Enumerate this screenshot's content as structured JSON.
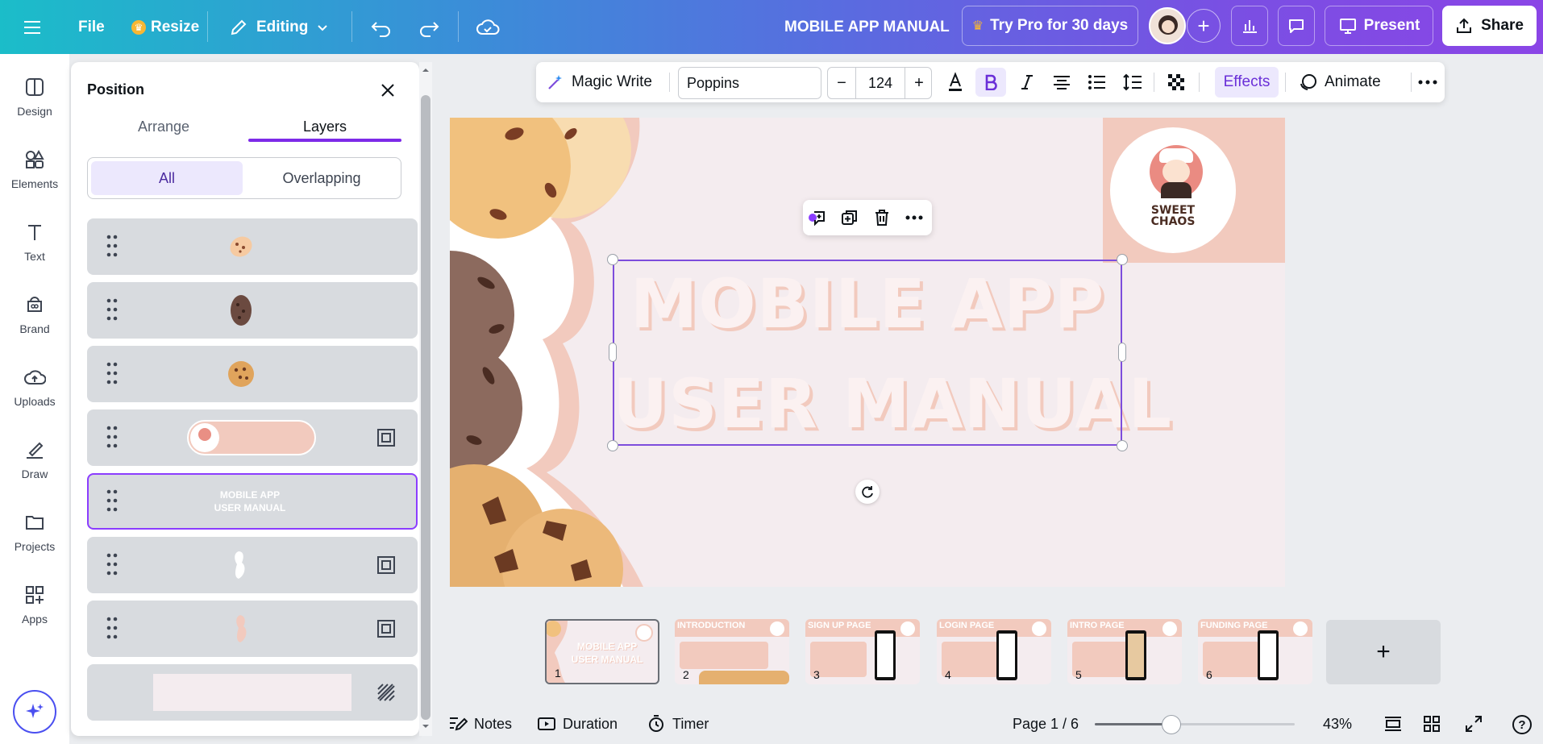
{
  "topbar": {
    "file_label": "File",
    "resize_label": "Resize",
    "editing_label": "Editing",
    "doc_title": "MOBILE APP MANUAL",
    "try_pro_label": "Try Pro for 30 days",
    "present_label": "Present",
    "share_label": "Share"
  },
  "rail": {
    "items": [
      {
        "label": "Design",
        "icon": "design-icon"
      },
      {
        "label": "Elements",
        "icon": "elements-icon"
      },
      {
        "label": "Text",
        "icon": "text-icon"
      },
      {
        "label": "Brand",
        "icon": "brand-icon"
      },
      {
        "label": "Uploads",
        "icon": "uploads-icon"
      },
      {
        "label": "Draw",
        "icon": "draw-icon"
      },
      {
        "label": "Projects",
        "icon": "projects-icon"
      },
      {
        "label": "Apps",
        "icon": "apps-icon"
      }
    ]
  },
  "panel": {
    "title": "Position",
    "tabs": [
      "Arrange",
      "Layers"
    ],
    "active_tab": "Layers",
    "filters": [
      "All",
      "Overlapping"
    ],
    "active_filter": "All",
    "selected_layer_text": "MOBILE APP\nUSER MANUAL",
    "selected_layer_line1": "MOBILE APP",
    "selected_layer_line2": "USER MANUAL"
  },
  "text_toolbar": {
    "magic_write_label": "Magic Write",
    "font_name": "Poppins",
    "font_size": "124",
    "minus_label": "−",
    "plus_label": "+",
    "effects_label": "Effects",
    "animate_label": "Animate"
  },
  "canvas": {
    "title_line1": "MOBILE APP",
    "title_line2": "USER MANUAL",
    "logo_line1": "SWEET",
    "logo_line2": "CHAOS",
    "accent_pink": "#f2cabe",
    "background": "#f4ecef",
    "selection_color": "#7d4ddc"
  },
  "pages": {
    "thumbs": [
      {
        "num": "1",
        "title": "MOBILE APP\nUSER MANUAL",
        "line1": "MOBILE APP",
        "line2": "USER MANUAL"
      },
      {
        "num": "2",
        "title": "INTRODUCTION"
      },
      {
        "num": "3",
        "title": "SIGN UP PAGE"
      },
      {
        "num": "4",
        "title": "LOGIN PAGE"
      },
      {
        "num": "5",
        "title": "INTRO PAGE"
      },
      {
        "num": "6",
        "title": "FUNDING PAGE"
      }
    ],
    "add_label": "+"
  },
  "bottom": {
    "notes_label": "Notes",
    "duration_label": "Duration",
    "timer_label": "Timer",
    "page_indicator": "Page 1 / 6",
    "zoom_percent": "43%",
    "zoom_value": 43,
    "help_label": "?"
  },
  "colors": {
    "brand_purple": "#7d2ae8",
    "share_bg": "#ffffff"
  }
}
